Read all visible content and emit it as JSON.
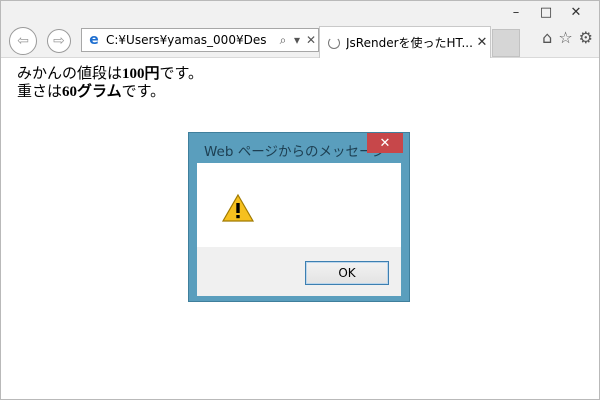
{
  "window_controls": {
    "minimize": "–",
    "maximize": "□",
    "close": "✕"
  },
  "navigation": {
    "back_icon": "back-arrow-icon",
    "forward_icon": "forward-arrow-icon"
  },
  "address_bar": {
    "url": "C:¥Users¥yamas_000¥Des",
    "search_glyph": "⌕",
    "dropdown_glyph": "▾",
    "refresh_glyph": "✕"
  },
  "tab": {
    "title": "JsRenderを使ったHT...",
    "close": "✕"
  },
  "toolbar_icons": {
    "home": "⌂",
    "favorites": "☆",
    "settings": "⚙"
  },
  "content": {
    "line1_prefix": "みかんの値段は",
    "line1_price": "100円",
    "line1_suffix": "です。",
    "line2_prefix": "重さは",
    "line2_weight": "60グラム",
    "line2_suffix": "です。"
  },
  "dialog": {
    "title": "Web ページからのメッセージ",
    "close": "✕",
    "ok_label": "OK",
    "icon": "warning-icon"
  },
  "colors": {
    "dialog_frame": "#5a9ebd",
    "dialog_close": "#c7474a",
    "ok_border": "#3c7fb1"
  }
}
